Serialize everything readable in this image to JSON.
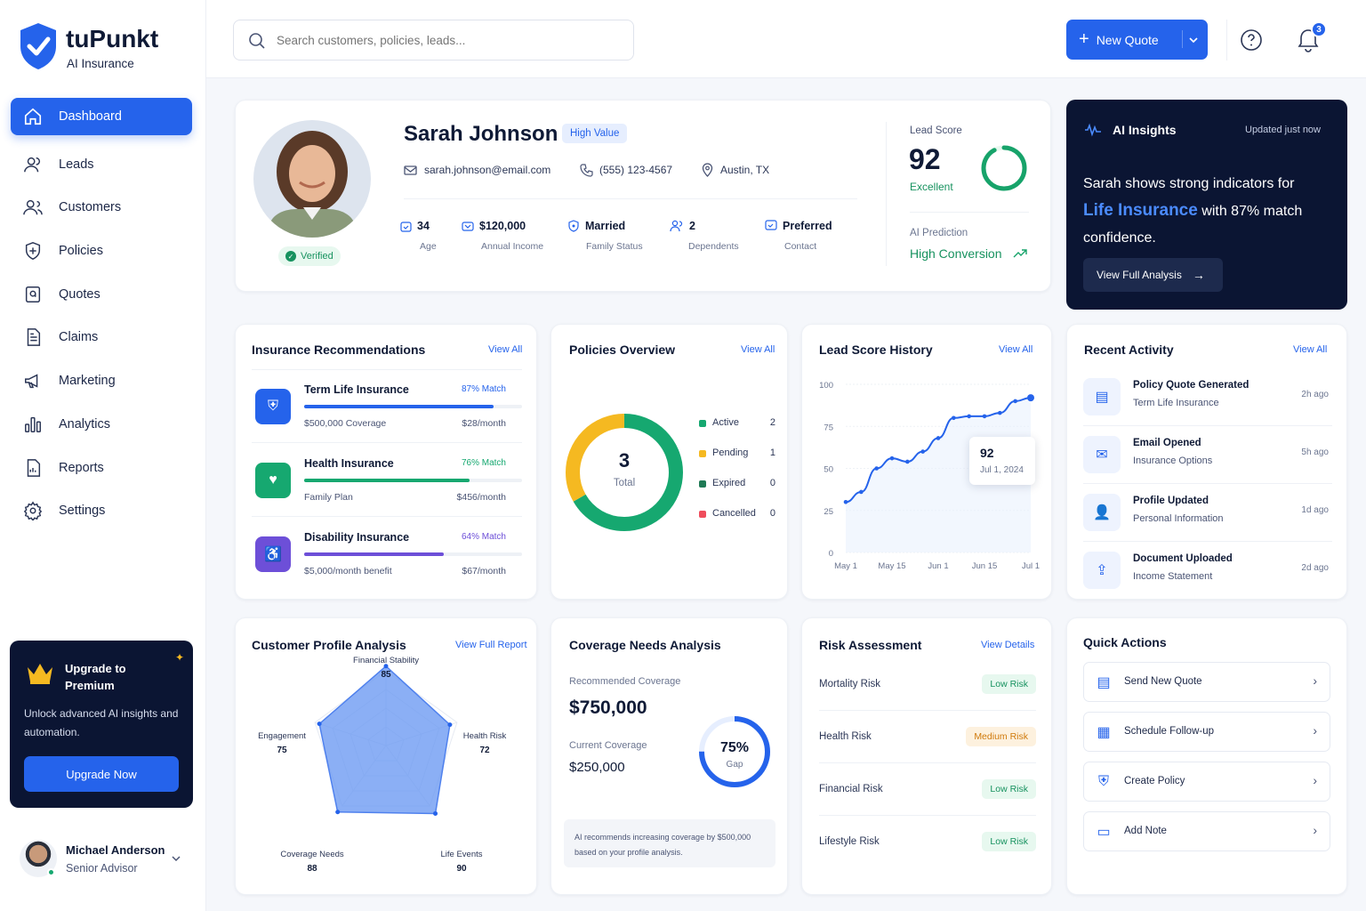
{
  "brand": {
    "name": "tuPunkt",
    "subtitle": "AI Insurance"
  },
  "nav": [
    {
      "label": "Dashboard",
      "icon": "home-icon"
    },
    {
      "label": "Leads",
      "icon": "users-icon"
    },
    {
      "label": "Customers",
      "icon": "user-group-icon"
    },
    {
      "label": "Policies",
      "icon": "shield-icon"
    },
    {
      "label": "Quotes",
      "icon": "quote-icon"
    },
    {
      "label": "Claims",
      "icon": "document-icon"
    },
    {
      "label": "Marketing",
      "icon": "megaphone-icon"
    },
    {
      "label": "Analytics",
      "icon": "bar-chart-icon"
    },
    {
      "label": "Reports",
      "icon": "report-icon"
    },
    {
      "label": "Settings",
      "icon": "gear-icon"
    }
  ],
  "upgrade": {
    "title": "Upgrade to Premium",
    "text": "Unlock advanced AI insights and automation.",
    "button": "Upgrade Now"
  },
  "user": {
    "name": "Michael Anderson",
    "role": "Senior Advisor"
  },
  "search": {
    "placeholder": "Search customers, policies, leads..."
  },
  "header": {
    "new_quote": "New Quote",
    "notifications": "3"
  },
  "profile": {
    "name": "Sarah Johnson",
    "badge": "High Value",
    "verified": "Verified",
    "email": "sarah.johnson@email.com",
    "phone": "(555) 123-4567",
    "location": "Austin, TX",
    "stats": [
      {
        "value": "34",
        "label": "Age"
      },
      {
        "value": "$120,000",
        "label": "Annual Income"
      },
      {
        "value": "Married",
        "label": "Family Status"
      },
      {
        "value": "2",
        "label": "Dependents"
      },
      {
        "value": "Preferred",
        "label": "Contact"
      }
    ],
    "lead_score_label": "Lead Score",
    "lead_score": "92",
    "lead_score_value": 0.92,
    "lead_score_text": "Excellent",
    "prediction_label": "AI Prediction",
    "prediction": "High Conversion"
  },
  "insights": {
    "title": "AI Insights",
    "updated": "Updated just now",
    "text1": "Sarah shows strong indicators for",
    "highlight": "Life Insurance",
    "text2": "with 87% match",
    "text3": "confidence.",
    "button": "View Full Analysis"
  },
  "recommendations": {
    "title": "Insurance Recommendations",
    "link": "View All",
    "items": [
      {
        "name": "Term Life Insurance",
        "match": "87% Match",
        "match_value": 0.87,
        "sub": "$500,000 Coverage",
        "price": "$28/month",
        "color": "#2563eb"
      },
      {
        "name": "Health Insurance",
        "match": "76% Match",
        "match_value": 0.76,
        "sub": "Family Plan",
        "price": "$456/month",
        "color": "#16a870"
      },
      {
        "name": "Disability Insurance",
        "match": "64% Match",
        "match_value": 0.64,
        "sub": "$5,000/month benefit",
        "price": "$67/month",
        "color": "#6d4fd8"
      }
    ]
  },
  "policies": {
    "title": "Policies Overview",
    "link": "View All",
    "total": "3",
    "total_label": "Total",
    "items": [
      {
        "label": "Active",
        "count": "2",
        "color": "#16a870"
      },
      {
        "label": "Pending",
        "count": "1",
        "color": "#f5b921"
      },
      {
        "label": "Expired",
        "count": "0",
        "color": "#1f7a55"
      },
      {
        "label": "Cancelled",
        "count": "0",
        "color": "#ef4d5c"
      }
    ]
  },
  "history": {
    "title": "Lead Score History",
    "link": "View All",
    "tooltip_value": "92",
    "tooltip_date": "Jul 1, 2024"
  },
  "chart_data": {
    "type": "line",
    "title": "Lead Score History",
    "x": [
      "May 1",
      "May 4",
      "May 8",
      "May 12",
      "May 15",
      "May 18",
      "May 22",
      "May 25",
      "Jun 1",
      "Jun 6",
      "Jun 11",
      "Jun 15",
      "Jun 20",
      "Jul 1"
    ],
    "y": [
      30,
      36,
      50,
      56,
      54,
      60,
      68,
      80,
      81,
      81,
      83,
      90,
      92
    ],
    "x_ticks": [
      "May 1",
      "May 15",
      "Jun 1",
      "Jun 15",
      "Jul 1"
    ],
    "y_ticks": [
      "100",
      "75",
      "50",
      "25",
      "0"
    ],
    "ylim": [
      0,
      100
    ],
    "grid": true
  },
  "activity": {
    "title": "Recent Activity",
    "link": "View All",
    "items": [
      {
        "title": "Policy Quote Generated",
        "sub": "Term Life Insurance",
        "time": "2h ago",
        "icon": "file-icon"
      },
      {
        "title": "Email Opened",
        "sub": "Insurance Options",
        "time": "5h ago",
        "icon": "mail-icon"
      },
      {
        "title": "Profile Updated",
        "sub": "Personal Information",
        "time": "1d ago",
        "icon": "user-icon"
      },
      {
        "title": "Document Uploaded",
        "sub": "Income Statement",
        "time": "2d ago",
        "icon": "upload-icon"
      }
    ]
  },
  "profile_analysis": {
    "title": "Customer Profile Analysis",
    "link": "View Full Report",
    "axes": [
      {
        "label": "Financial Stability",
        "value": "85"
      },
      {
        "label": "Health Risk",
        "value": "72"
      },
      {
        "label": "Life Events",
        "value": "90"
      },
      {
        "label": "Coverage Needs",
        "value": "88"
      },
      {
        "label": "Engagement",
        "value": "75"
      }
    ]
  },
  "coverage": {
    "title": "Coverage Needs Analysis",
    "rec_label": "Recommended Coverage",
    "rec_value": "$750,000",
    "cur_label": "Current Coverage",
    "cur_value": "$250,000",
    "gap": "75%",
    "gap_label": "Gap",
    "gap_value": 0.75,
    "note": "AI recommends increasing coverage by $500,000 based on your profile analysis."
  },
  "risk": {
    "title": "Risk Assessment",
    "link": "View Details",
    "items": [
      {
        "label": "Mortality Risk",
        "level": "Low Risk",
        "kind": "low"
      },
      {
        "label": "Health Risk",
        "level": "Medium Risk",
        "kind": "med"
      },
      {
        "label": "Financial Risk",
        "level": "Low Risk",
        "kind": "low"
      },
      {
        "label": "Lifestyle Risk",
        "level": "Low Risk",
        "kind": "low"
      }
    ]
  },
  "quick": {
    "title": "Quick Actions",
    "items": [
      {
        "label": "Send New Quote",
        "icon": "quote-doc-icon"
      },
      {
        "label": "Schedule Follow-up",
        "icon": "calendar-icon"
      },
      {
        "label": "Create Policy",
        "icon": "shield-check-icon"
      },
      {
        "label": "Add Note",
        "icon": "note-icon"
      }
    ]
  }
}
